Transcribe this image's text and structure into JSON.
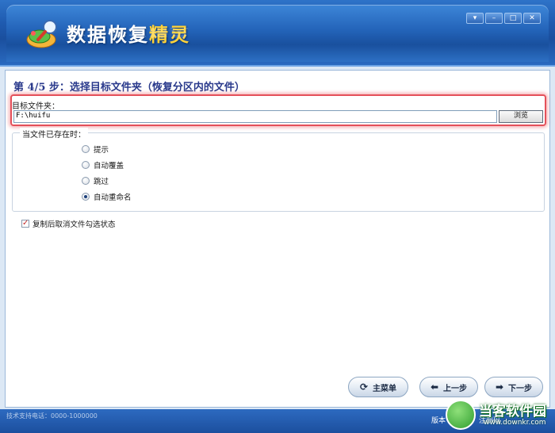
{
  "window": {
    "title_main": "数据恢复",
    "title_accent": "精灵",
    "controls": [
      "▾",
      "–",
      "□",
      "✕"
    ]
  },
  "wizard": {
    "step_title": "第 4/5 步：选择目标文件夹（恢复分区内的文件）",
    "target_label": "目标文件夹：",
    "target_path": "F:\\huifu",
    "browse_label": "浏览",
    "exists_group_label": "当文件已存在时：",
    "options": [
      {
        "label": "提示",
        "checked": false
      },
      {
        "label": "自动覆盖",
        "checked": false
      },
      {
        "label": "跳过",
        "checked": false
      },
      {
        "label": "自动重命名",
        "checked": true
      }
    ],
    "uncheck_after_copy_label": "复制后取消文件勾选状态",
    "uncheck_after_copy_checked": true
  },
  "nav": {
    "main_menu": "主菜单",
    "prev": "上一步",
    "next": "下一步"
  },
  "statusbar": {
    "left_text": "技术支持电话：0000-1000000",
    "version_label": "版本",
    "version_value": "3",
    "more_text": "注册码"
  },
  "watermark": {
    "title": "当客软件园",
    "url": "www.downkr.com"
  }
}
